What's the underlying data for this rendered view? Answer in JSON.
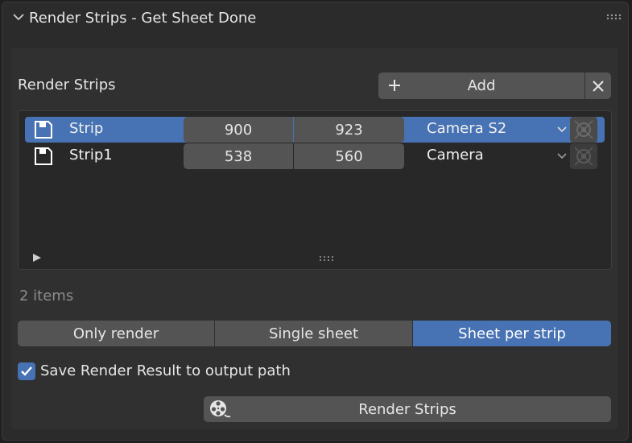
{
  "panel": {
    "title": "Render Strips - Get Sheet Done"
  },
  "section": {
    "label": "Render Strips",
    "add_label": "Add"
  },
  "strips": [
    {
      "name": "Strip",
      "start": "900",
      "end": "923",
      "camera": "Camera S2",
      "selected": true
    },
    {
      "name": "Strip1",
      "start": "538",
      "end": "560",
      "camera": "Camera",
      "selected": false
    }
  ],
  "count_text": "2 items",
  "modes": {
    "options": [
      "Only render",
      "Single sheet",
      "Sheet per strip"
    ],
    "selected": "Sheet per strip"
  },
  "save_result": {
    "label": "Save Render Result to output path",
    "checked": true
  },
  "render_button": {
    "label": "Render Strips"
  },
  "colors": {
    "accent": "#4772b3",
    "button": "#545454",
    "panel": "#2b2b2b"
  }
}
